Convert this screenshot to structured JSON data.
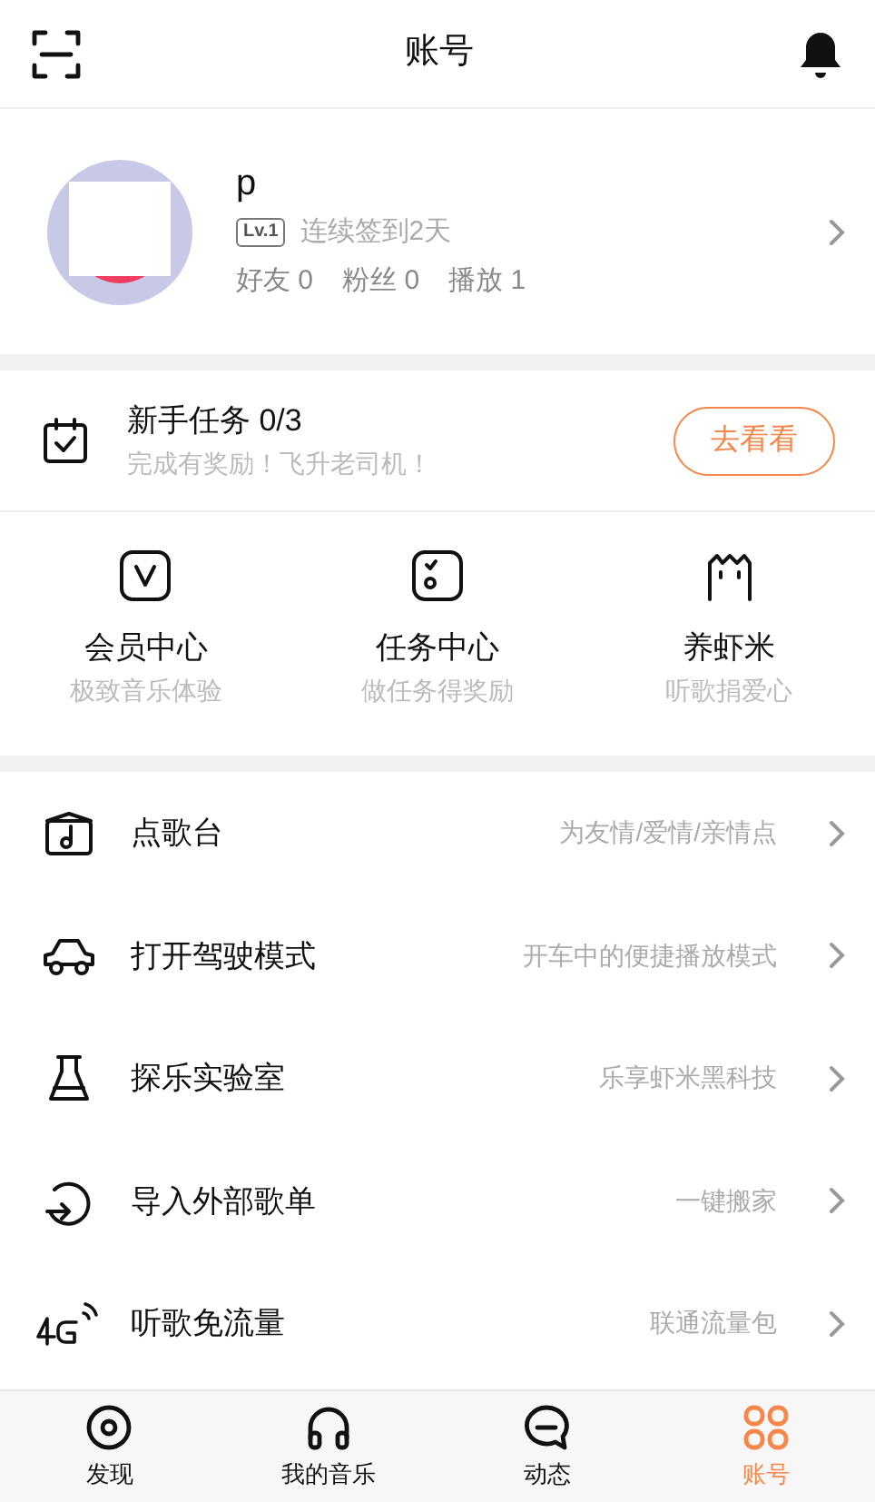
{
  "header": {
    "title": "账号"
  },
  "profile": {
    "name": "p",
    "level": "Lv.1",
    "checkin": "连续签到2天",
    "stats": [
      {
        "label": "好友",
        "value": "0"
      },
      {
        "label": "粉丝",
        "value": "0"
      },
      {
        "label": "播放",
        "value": "1"
      }
    ]
  },
  "task": {
    "title": "新手任务 0/3",
    "subtitle": "完成有奖励！飞升老司机！",
    "button": "去看看"
  },
  "features": [
    {
      "kind": "vip",
      "title": "会员中心",
      "subtitle": "极致音乐体验"
    },
    {
      "kind": "task",
      "title": "任务中心",
      "subtitle": "做任务得奖励"
    },
    {
      "kind": "pet",
      "title": "养虾米",
      "subtitle": "听歌捐爱心"
    }
  ],
  "menu": [
    {
      "kind": "song",
      "label": "点歌台",
      "hint": "为友情/爱情/亲情点"
    },
    {
      "kind": "car",
      "label": "打开驾驶模式",
      "hint": "开车中的便捷播放模式"
    },
    {
      "kind": "lab",
      "label": "探乐实验室",
      "hint": "乐享虾米黑科技"
    },
    {
      "kind": "import",
      "label": "导入外部歌单",
      "hint": "一键搬家"
    },
    {
      "kind": "mobiledata",
      "label": "听歌免流量",
      "hint": "联通流量包"
    }
  ],
  "tabbar": [
    {
      "kind": "discover",
      "label": "发现",
      "selected": false
    },
    {
      "kind": "music",
      "label": "我的音乐",
      "selected": false
    },
    {
      "kind": "feed",
      "label": "动态",
      "selected": false
    },
    {
      "kind": "account",
      "label": "账号",
      "selected": true
    }
  ]
}
